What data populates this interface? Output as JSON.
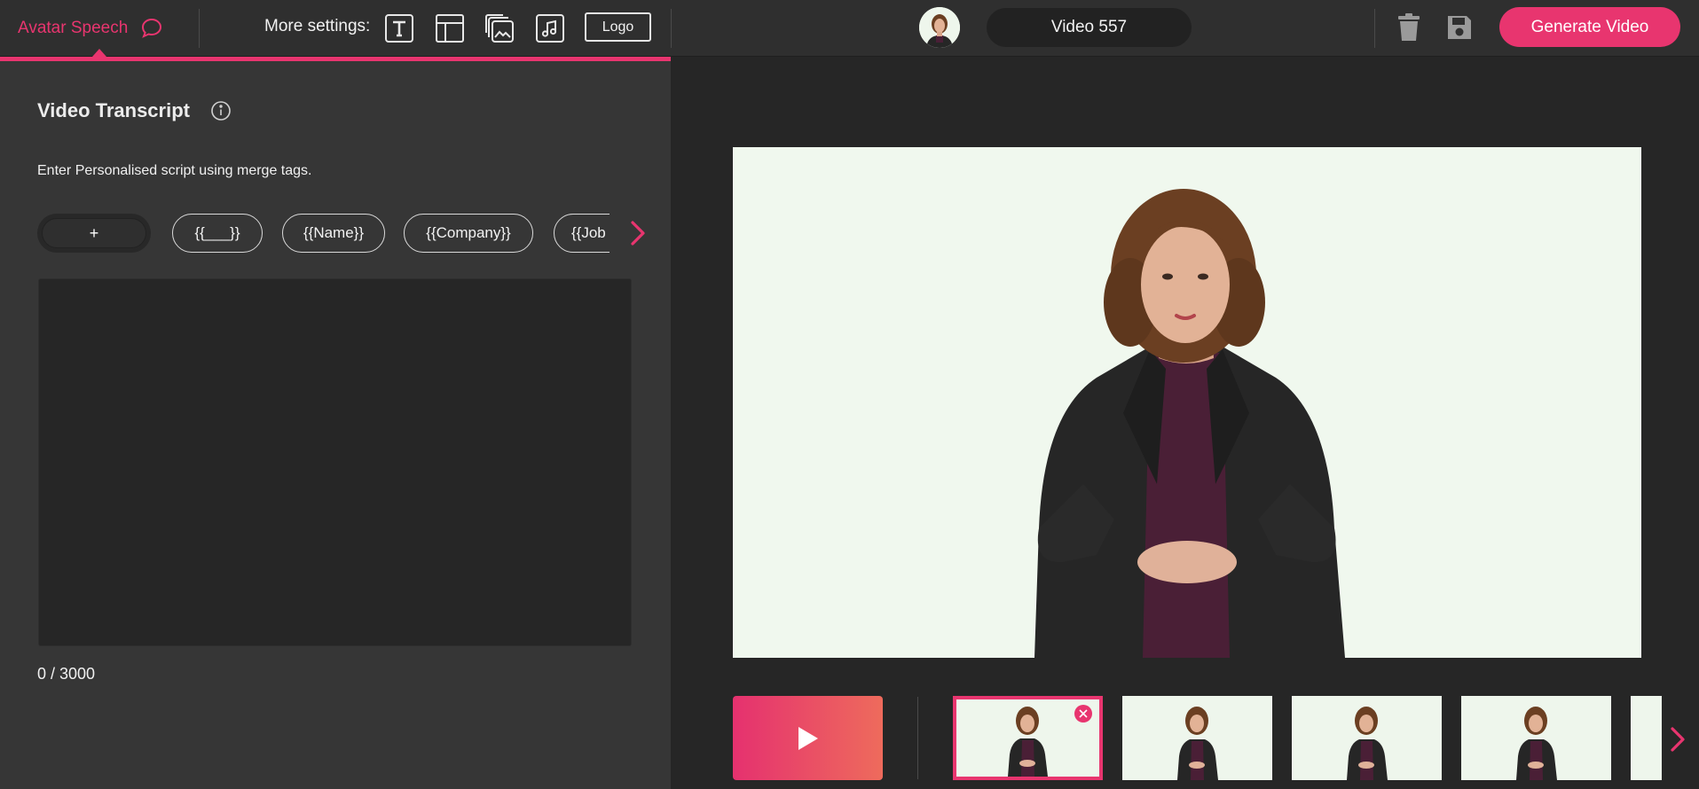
{
  "header": {
    "avatar_speech_label": "Avatar Speech",
    "more_settings_label": "More settings:",
    "logo_label": "Logo",
    "video_title": "Video 557",
    "generate_label": "Generate Video"
  },
  "colors": {
    "accent": "#e8356f",
    "background": "#262626",
    "panel": "#363636",
    "topbar": "#2f2f2f",
    "preview_bg": "#f0f8ee"
  },
  "icons": {
    "tab": "chat-bubble-icon",
    "tools": [
      "text-icon",
      "layout-icon",
      "media-icon",
      "music-note-icon"
    ],
    "actions": [
      "trash-icon",
      "save-icon"
    ],
    "play": "play-icon",
    "next": "chevron-right-icon",
    "remove": "close-icon",
    "info": "info-icon"
  },
  "transcript": {
    "title": "Video Transcript",
    "hint": "Enter Personalised script using merge tags.",
    "add_tag_label": "+",
    "merge_tags": [
      "{{___}}",
      "{{Name}}",
      "{{Company}}",
      "{{Job"
    ],
    "value": "",
    "char_count": "0 / 3000"
  },
  "scenes": {
    "count": 5,
    "active_index": 0
  }
}
